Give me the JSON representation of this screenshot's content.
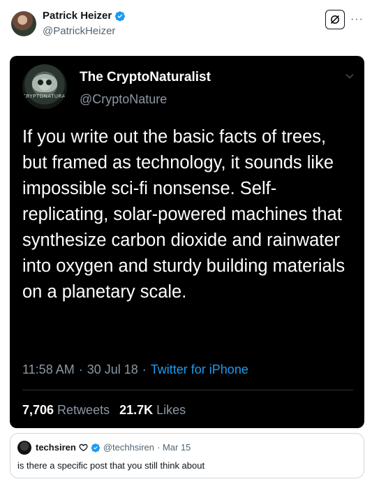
{
  "tweet": {
    "author_name": "Patrick Heizer",
    "author_handle": "@PatrickHeizer",
    "more_label": "···"
  },
  "embedded": {
    "author_name": "The CryptoNaturalist",
    "author_handle": "@CryptoNature",
    "avatar_text": "CRYPTONATURALIST",
    "body": "If you write out the basic facts of trees, but framed as technology, it sounds like impossible sci-fi nonsense. Self-replicating, solar-powered machines that synthesize carbon dioxide and rainwater into oxygen and sturdy building materials on a planetary scale.",
    "time": "11:58 AM",
    "date": "30 Jul 18",
    "source": "Twitter for iPhone",
    "separator": "·",
    "retweets_count": "7,706",
    "retweets_label": "Retweets",
    "likes_count": "21.7K",
    "likes_label": "Likes"
  },
  "quote": {
    "author_name": "techsiren",
    "author_handle": "@techhsiren",
    "date": "· Mar 15",
    "text": "is there a specific post that you still think about"
  },
  "colors": {
    "verified": "#1d9bf0",
    "link": "#1d9bf0",
    "dark_bg": "#000000"
  }
}
